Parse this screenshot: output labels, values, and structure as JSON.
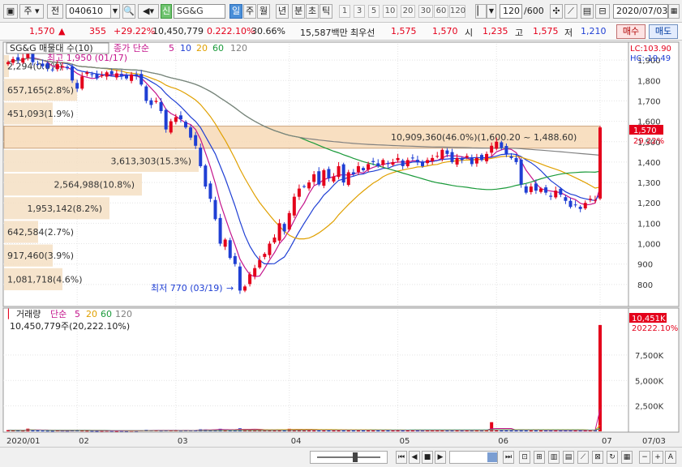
{
  "toolbar": {
    "mode": "주",
    "market": "전",
    "code": "040610",
    "badge": "신",
    "name": "SG&G",
    "periods": [
      "일",
      "주",
      "월",
      "년",
      "분",
      "초",
      "틱"
    ],
    "active_period": "일",
    "numbers": [
      "1",
      "3",
      "5",
      "10",
      "20",
      "30",
      "60",
      "120"
    ],
    "view_count": "120",
    "view_total": "/600",
    "date": "2020/07/03"
  },
  "quote": {
    "price": "1,570",
    "change_arrow": "▲",
    "change": "355",
    "change_rate": "+29.22%",
    "volume": "10,450,779",
    "volume_ratio": "0.222.10%",
    "turnover": "30.66%",
    "amount": "15,587백만",
    "best_label": "최우선",
    "best_ask": "1,575",
    "best_bid": "1,570",
    "open_label": "시",
    "open": "1,235",
    "high_label": "고",
    "high": "1,575",
    "low_label": "저",
    "low": "1,210",
    "buy_label": "매수",
    "sell_label": "매도"
  },
  "price_panel": {
    "title": "SG&G 매물대 수(10)",
    "legend_prefix": "종가 단순",
    "ma": [
      {
        "period": "5",
        "color": "#c4148c"
      },
      {
        "period": "10",
        "color": "#1f3fd4"
      },
      {
        "period": "20",
        "color": "#e0a000"
      },
      {
        "period": "60",
        "color": "#1a9a3a"
      },
      {
        "period": "120",
        "color": "#808080"
      }
    ],
    "lc": "LC:103.90",
    "hc": "HC:-19.49",
    "high_annotation": "최고 1,950 (01/17)",
    "low_annotation": "최저 770 (03/19)",
    "current_price_label": "1,570",
    "current_change_label": "29.22%",
    "y_ticks": [
      "1,900",
      "1,800",
      "1,700",
      "1,600",
      "1,500",
      "1,400",
      "1,300",
      "1,200",
      "1,100",
      "1,000",
      "900",
      "800"
    ],
    "volume_profile": [
      {
        "label": "2,294(0.0%)"
      },
      {
        "label": "657,165(2.8%)"
      },
      {
        "label": "451,093(1.9%)"
      },
      {
        "label": "10,909,360(46.0%)(1,600.20 ~ 1,488.60)"
      },
      {
        "label": "3,613,303(15.3%)"
      },
      {
        "label": "2,564,988(10.8%)"
      },
      {
        "label": "1,953,142(8.2%)"
      },
      {
        "label": "642,584(2.7%)"
      },
      {
        "label": "917,460(3.9%)"
      },
      {
        "label": "1,081,718(4.6%)"
      }
    ]
  },
  "volume_panel": {
    "title": "거래량",
    "legend_prefix": "단순",
    "ma": [
      {
        "period": "5",
        "color": "#c4148c"
      },
      {
        "period": "20",
        "color": "#e0a000"
      },
      {
        "period": "60",
        "color": "#1a9a3a"
      },
      {
        "period": "120",
        "color": "#808080"
      }
    ],
    "info": "10,450,779주(20,222.10%)",
    "last_volume_label": "10,451K",
    "last_ratio_label": "20222.10%",
    "y_ticks": [
      "7,500K",
      "5,000K",
      "2,500K"
    ]
  },
  "x_labels": [
    "2020/01",
    "02",
    "03",
    "04",
    "05",
    "06",
    "07",
    "07/03"
  ],
  "colors": {
    "up": "#e4001b",
    "down": "#1f3fd4",
    "profile": "#f5dfc3",
    "profile_max": "#f7d9b6"
  },
  "chart_data": {
    "type": "candlestick",
    "x_months": [
      "2020/01",
      "02",
      "03",
      "04",
      "05",
      "06",
      "07"
    ],
    "y_range": [
      700,
      1980
    ],
    "y_high": 1950,
    "y_low": 770,
    "close": [
      1890,
      1905,
      1900,
      1910,
      1950,
      1890,
      1880,
      1870,
      1860,
      1850,
      1880,
      1870,
      1860,
      1800,
      1760,
      1820,
      1840,
      1830,
      1810,
      1825,
      1840,
      1830,
      1835,
      1820,
      1810,
      1830,
      1820,
      1780,
      1700,
      1680,
      1700,
      1650,
      1560,
      1600,
      1620,
      1610,
      1570,
      1520,
      1480,
      1380,
      1280,
      1220,
      1120,
      1000,
      1020,
      930,
      900,
      770,
      790,
      850,
      880,
      920,
      950,
      1000,
      1030,
      1100,
      1060,
      1150,
      1230,
      1270,
      1280,
      1300,
      1340,
      1290,
      1360,
      1320,
      1330,
      1380,
      1300,
      1350,
      1340,
      1380,
      1360,
      1390,
      1400,
      1380,
      1410,
      1390,
      1400,
      1420,
      1380,
      1410,
      1420,
      1400,
      1380,
      1410,
      1420,
      1430,
      1460,
      1440,
      1400,
      1420,
      1410,
      1430,
      1390,
      1420,
      1410,
      1440,
      1480,
      1500,
      1470,
      1440,
      1420,
      1400,
      1290,
      1250,
      1280,
      1260,
      1270,
      1250,
      1230,
      1260,
      1240,
      1210,
      1180,
      1190,
      1170,
      1200,
      1220,
      1215,
      1570
    ],
    "volume_k": [
      120,
      80,
      90,
      70,
      260,
      150,
      90,
      70,
      60,
      50,
      80,
      70,
      60,
      100,
      90,
      70,
      60,
      50,
      40,
      50,
      60,
      50,
      40,
      50,
      40,
      60,
      50,
      80,
      150,
      90,
      100,
      70,
      120,
      90,
      80,
      70,
      100,
      90,
      120,
      200,
      180,
      130,
      150,
      250,
      120,
      130,
      170,
      300,
      230,
      180,
      150,
      130,
      120,
      150,
      130,
      200,
      120,
      250,
      200,
      180,
      160,
      150,
      170,
      140,
      160,
      130,
      120,
      140,
      110,
      120,
      110,
      130,
      110,
      120,
      130,
      110,
      120,
      100,
      110,
      120,
      100,
      110,
      100,
      90,
      100,
      110,
      100,
      120,
      130,
      110,
      100,
      90,
      100,
      120,
      90,
      100,
      110,
      120,
      900,
      150,
      120,
      110,
      100,
      90,
      200,
      120,
      110,
      100,
      110,
      90,
      100,
      110,
      100,
      90,
      100,
      90,
      80,
      90,
      100,
      120,
      10451
    ]
  }
}
